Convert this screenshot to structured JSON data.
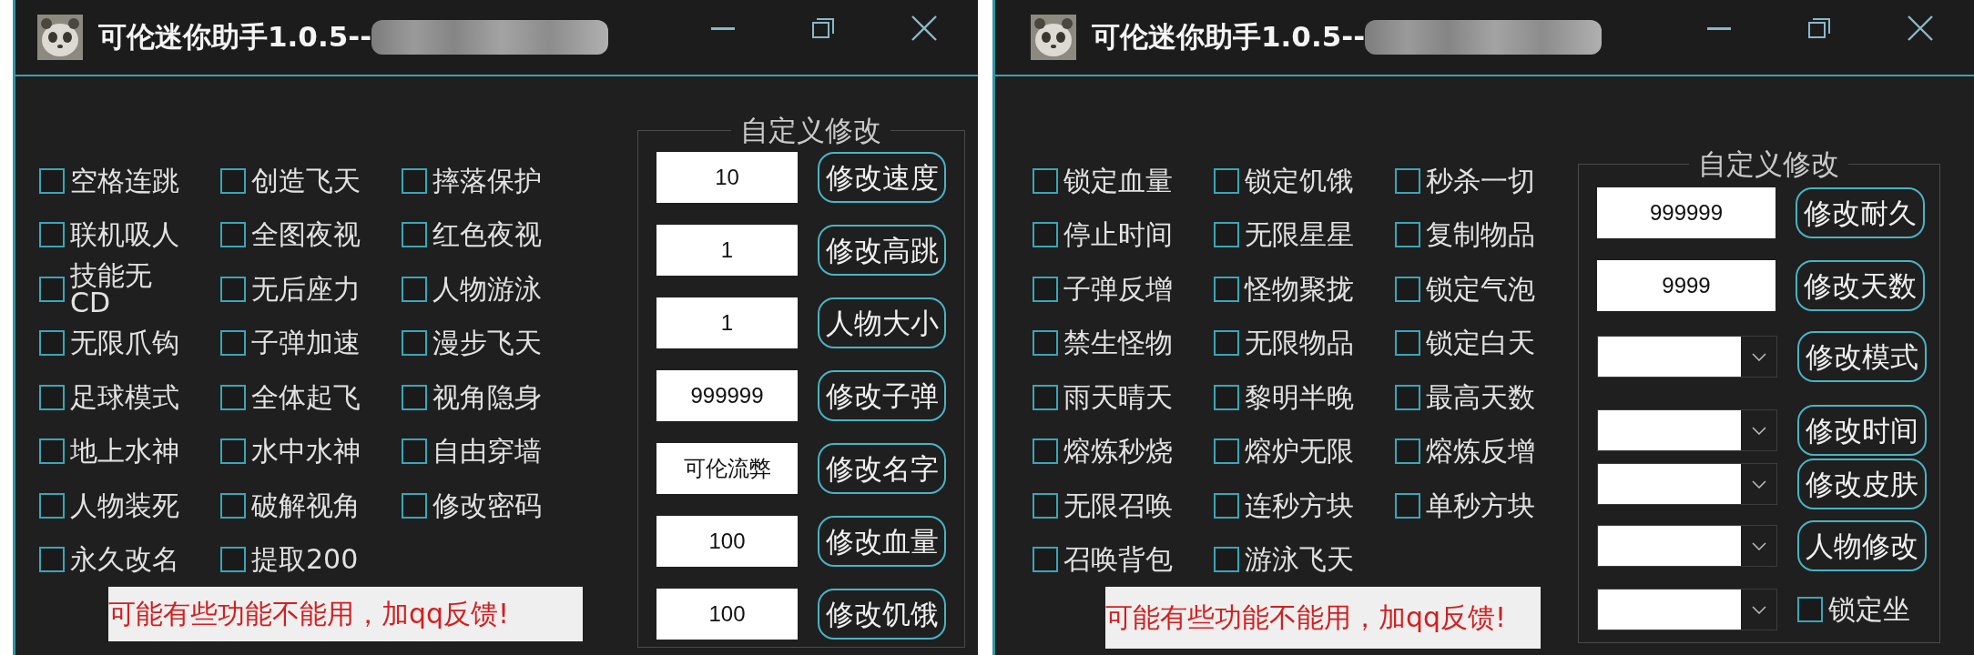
{
  "windows": [
    {
      "title": "可伦迷你助手1.0.5--",
      "options": [
        {
          "label": "空格连跳",
          "checked": false
        },
        {
          "label": "创造飞天",
          "checked": false
        },
        {
          "label": "摔落保护",
          "checked": false
        },
        {
          "label": "联机吸人",
          "checked": false
        },
        {
          "label": "全图夜视",
          "checked": false
        },
        {
          "label": "红色夜视",
          "checked": false
        },
        {
          "label": "技能无CD",
          "checked": false
        },
        {
          "label": "无后座力",
          "checked": false
        },
        {
          "label": "人物游泳",
          "checked": false
        },
        {
          "label": "无限爪钩",
          "checked": false
        },
        {
          "label": "子弹加速",
          "checked": false
        },
        {
          "label": "漫步飞天",
          "checked": false
        },
        {
          "label": "足球模式",
          "checked": false
        },
        {
          "label": "全体起飞",
          "checked": false
        },
        {
          "label": "视角隐身",
          "checked": false
        },
        {
          "label": "地上水神",
          "checked": false
        },
        {
          "label": "水中水神",
          "checked": false
        },
        {
          "label": "自由穿墙",
          "checked": false
        },
        {
          "label": "人物装死",
          "checked": false
        },
        {
          "label": "破解视角",
          "checked": false
        },
        {
          "label": "修改密码",
          "checked": false
        },
        {
          "label": "永久改名",
          "checked": false
        },
        {
          "label": "提取200",
          "checked": false
        }
      ],
      "custom_panel": {
        "title": "自定义修改",
        "rows": [
          {
            "field": {
              "kind": "input",
              "value": "10"
            },
            "action": {
              "kind": "button",
              "label": "修改速度"
            }
          },
          {
            "field": {
              "kind": "input",
              "value": "1"
            },
            "action": {
              "kind": "button",
              "label": "修改高跳"
            }
          },
          {
            "field": {
              "kind": "input",
              "value": "1"
            },
            "action": {
              "kind": "button",
              "label": "人物大小"
            }
          },
          {
            "field": {
              "kind": "input",
              "value": "999999"
            },
            "action": {
              "kind": "button",
              "label": "修改子弹"
            }
          },
          {
            "field": {
              "kind": "input",
              "value": "可伦流弊"
            },
            "action": {
              "kind": "button",
              "label": "修改名字"
            }
          },
          {
            "field": {
              "kind": "input",
              "value": "100"
            },
            "action": {
              "kind": "button",
              "label": "修改血量"
            }
          },
          {
            "field": {
              "kind": "input",
              "value": "100"
            },
            "action": {
              "kind": "button",
              "label": "修改饥饿"
            }
          }
        ]
      },
      "notice": "可能有些功能不能用，加qq反馈!"
    },
    {
      "title": "可伦迷你助手1.0.5--",
      "options": [
        {
          "label": "锁定血量",
          "checked": false
        },
        {
          "label": "锁定饥饿",
          "checked": false
        },
        {
          "label": "秒杀一切",
          "checked": false
        },
        {
          "label": "停止时间",
          "checked": false
        },
        {
          "label": "无限星星",
          "checked": false
        },
        {
          "label": "复制物品",
          "checked": false
        },
        {
          "label": "子弹反增",
          "checked": false
        },
        {
          "label": "怪物聚拢",
          "checked": false
        },
        {
          "label": "锁定气泡",
          "checked": false
        },
        {
          "label": "禁生怪物",
          "checked": false
        },
        {
          "label": "无限物品",
          "checked": false
        },
        {
          "label": "锁定白天",
          "checked": false
        },
        {
          "label": "雨天晴天",
          "checked": false
        },
        {
          "label": "黎明半晚",
          "checked": false
        },
        {
          "label": "最高天数",
          "checked": false
        },
        {
          "label": "熔炼秒烧",
          "checked": false
        },
        {
          "label": "熔炉无限",
          "checked": false
        },
        {
          "label": "熔炼反增",
          "checked": false
        },
        {
          "label": "无限召唤",
          "checked": false
        },
        {
          "label": "连秒方块",
          "checked": false
        },
        {
          "label": "单秒方块",
          "checked": false
        },
        {
          "label": "召唤背包",
          "checked": false
        },
        {
          "label": "游泳飞天",
          "checked": false
        }
      ],
      "custom_panel": {
        "title": "自定义修改",
        "rows": [
          {
            "field": {
              "kind": "input",
              "value": "999999"
            },
            "action": {
              "kind": "button",
              "label": "修改耐久"
            }
          },
          {
            "field": {
              "kind": "input",
              "value": "9999"
            },
            "action": {
              "kind": "button",
              "label": "修改天数"
            }
          },
          {
            "field": {
              "kind": "combo"
            },
            "action": {
              "kind": "button",
              "label": "修改模式"
            }
          },
          {
            "field": {
              "kind": "combo"
            },
            "action": {
              "kind": "button",
              "label": "修改时间"
            }
          },
          {
            "field": {
              "kind": "combo"
            },
            "action": {
              "kind": "button",
              "label": "修改皮肤"
            }
          },
          {
            "field": {
              "kind": "combo"
            },
            "action": {
              "kind": "button",
              "label": "人物修改"
            }
          },
          {
            "field": {
              "kind": "combo"
            },
            "action": {
              "kind": "checkbox",
              "label": "锁定坐",
              "checked": false
            }
          }
        ]
      },
      "notice": "可能有些功能不能用，加qq反馈!"
    }
  ]
}
